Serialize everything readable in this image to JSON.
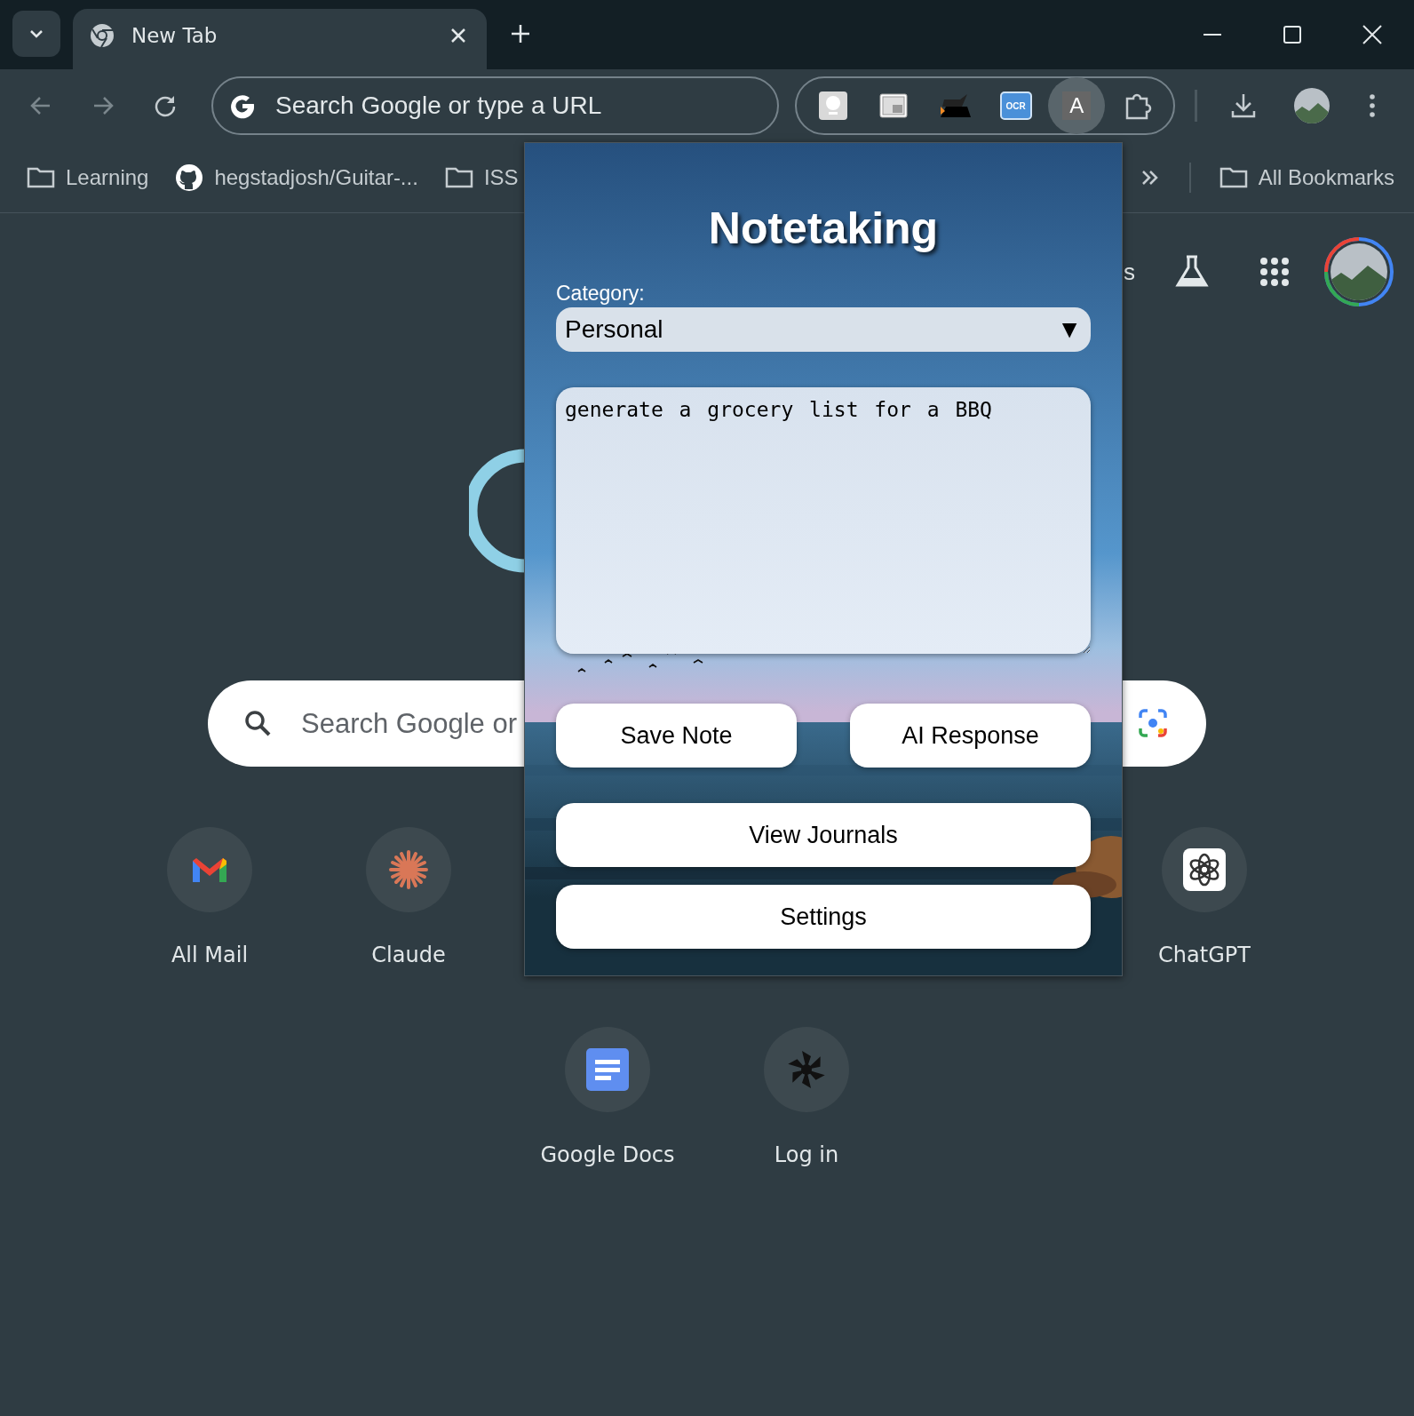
{
  "browser": {
    "tab_title": "New Tab",
    "omnibox": {
      "placeholder": "Search Google or type a URL"
    },
    "extensions": [
      {
        "kind": "bulb",
        "highlighted": false
      },
      {
        "kind": "window",
        "highlighted": false
      },
      {
        "kind": "shape",
        "highlighted": false
      },
      {
        "kind": "ocr",
        "label": "OCR",
        "highlighted": false
      },
      {
        "kind": "letter",
        "label": "A",
        "highlighted": true
      },
      {
        "kind": "puzzle",
        "highlighted": false
      }
    ],
    "bookmarks": [
      {
        "kind": "folder",
        "label": "Learning"
      },
      {
        "kind": "github",
        "label": "hegstadjosh/Guitar-..."
      },
      {
        "kind": "folder",
        "label": "ISS"
      }
    ],
    "all_bookmarks": "All Bookmarks"
  },
  "new_tab": {
    "cut_text": "s",
    "search": {
      "placeholder": "Search Google or"
    },
    "shortcuts_left": [
      {
        "kind": "mail",
        "label": "All Mail"
      },
      {
        "kind": "spark",
        "label": "Claude"
      }
    ],
    "shortcuts_right": [
      {
        "kind": "knot",
        "label": "ChatGPT"
      }
    ],
    "shortcuts_row_2": [
      {
        "kind": "doc",
        "label": "Google Docs"
      },
      {
        "kind": "pinwheel",
        "label": "Log in"
      }
    ]
  },
  "popup": {
    "title": "Notetaking",
    "category_label": "Category:",
    "category": {
      "value": "Personal",
      "arrow": "▼"
    },
    "note": {
      "value": "generate a grocery list for a BBQ"
    },
    "buttons_row": [
      "Save Note",
      "AI Response"
    ],
    "buttons": [
      "View Journals",
      "Settings"
    ]
  }
}
